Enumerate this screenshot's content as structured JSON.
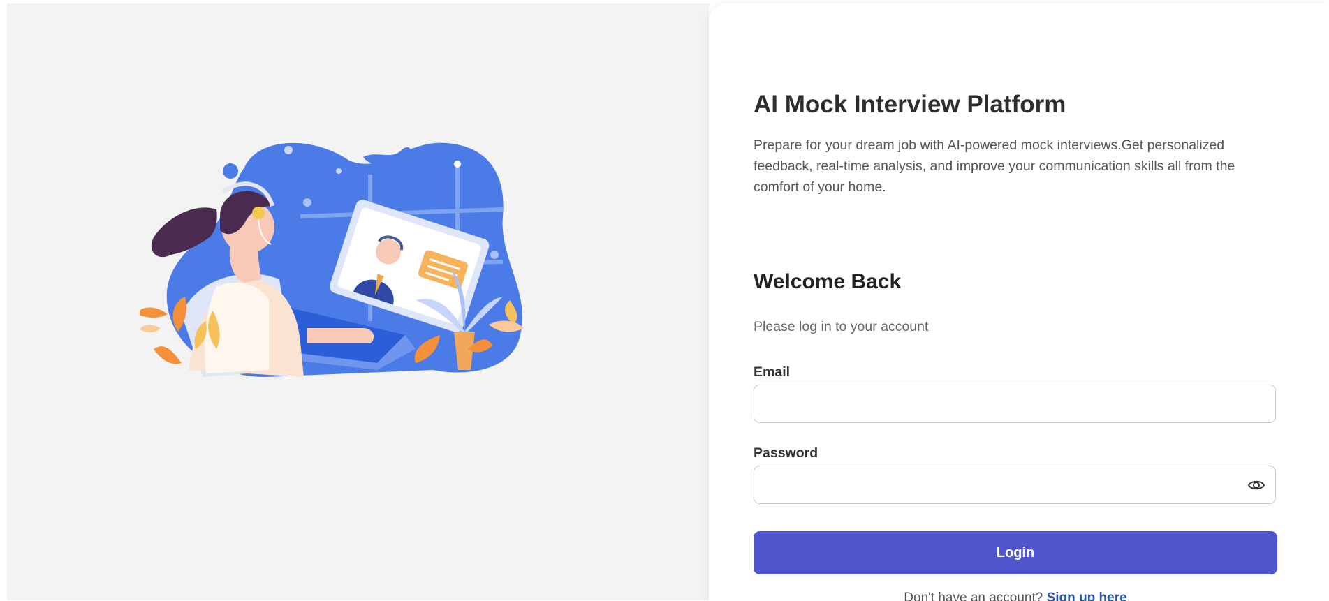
{
  "hero": {
    "title": "AI Mock Interview Platform",
    "description": "Prepare for your dream job with AI-powered mock interviews.Get personalized feedback, real-time analysis, and improve your communication skills all from the comfort of your home."
  },
  "login": {
    "heading": "Welcome Back",
    "subtitle": "Please log in to your account",
    "email_label": "Email",
    "email_value": "",
    "password_label": "Password",
    "password_value": "",
    "submit_label": "Login",
    "signup_prompt": "Don't have an account?",
    "signup_link": "Sign up here"
  },
  "icons": {
    "password_toggle": "eye-icon"
  },
  "colors": {
    "primary_button": "#4f55cc",
    "link": "#2a58a8",
    "left_panel_bg": "#f3f3f3",
    "illustration_blue": "#4a7be6"
  }
}
